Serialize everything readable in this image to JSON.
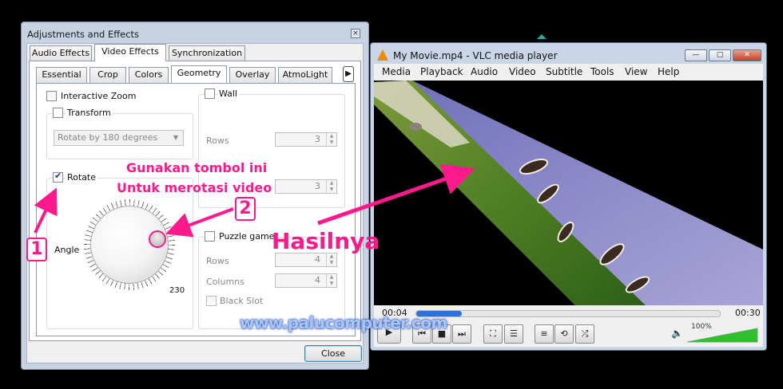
{
  "adjustments": {
    "title": "Adjustments and Effects",
    "close_glyph": "×",
    "tabs": [
      {
        "label": "Audio Effects",
        "selected": false
      },
      {
        "label": "Video Effects",
        "selected": true
      },
      {
        "label": "Synchronization",
        "selected": false
      }
    ],
    "subtabs": [
      {
        "label": "Essential"
      },
      {
        "label": "Crop"
      },
      {
        "label": "Colors"
      },
      {
        "label": "Geometry",
        "selected": true
      },
      {
        "label": "Overlay"
      },
      {
        "label": "AtmoLight"
      }
    ],
    "interactive_zoom": {
      "label": "Interactive Zoom",
      "checked": false
    },
    "transform": {
      "label": "Transform",
      "checked": false,
      "select_value": "Rotate by 180 degrees"
    },
    "rotate": {
      "label": "Rotate",
      "checked": true,
      "angle_label": "Angle",
      "angle_value": "230"
    },
    "wall": {
      "label": "Wall",
      "checked": false,
      "rows_label": "Rows",
      "rows_value": "3",
      "cols_value": "3"
    },
    "puzzle": {
      "label": "Puzzle game",
      "checked": false,
      "rows_label": "Rows",
      "rows_value": "4",
      "columns_label": "Columns",
      "columns_value": "4",
      "black_slot_label": "Black Slot",
      "black_slot_checked": false
    },
    "close_button": "Close",
    "tab_scroll_arrow": "▶"
  },
  "vlc": {
    "title": "My Movie.mp4 - VLC media player",
    "window_buttons": {
      "minimize": "—",
      "maximize": "▢",
      "close": "✕"
    },
    "menu": [
      "Media",
      "Playback",
      "Audio",
      "Video",
      "Subtitle",
      "Tools",
      "View",
      "Help"
    ],
    "time_elapsed": "00:04",
    "time_total": "00:30",
    "progress": 0.15,
    "volume_label": "100%",
    "volume": 1.0,
    "buttons": {
      "play": "▶",
      "prev": "⏮",
      "stop": "■",
      "next": "⏭",
      "fullscreen": "⛶",
      "extended": "☰",
      "playlist": "≡",
      "loop": "⟲",
      "random": "⤮",
      "speaker": "🔈"
    }
  },
  "annotations": {
    "step1": "1",
    "step2": "2",
    "instruction_line1": "Gunakan tombol ini",
    "instruction_line2": "Untuk merotasi video",
    "result_label": "Hasilnya",
    "watermark": "www.palucomputer.com"
  },
  "colors": {
    "accent": "#ff1a8c",
    "progress": "#2b73d6",
    "volume": "#2fbf2f"
  }
}
